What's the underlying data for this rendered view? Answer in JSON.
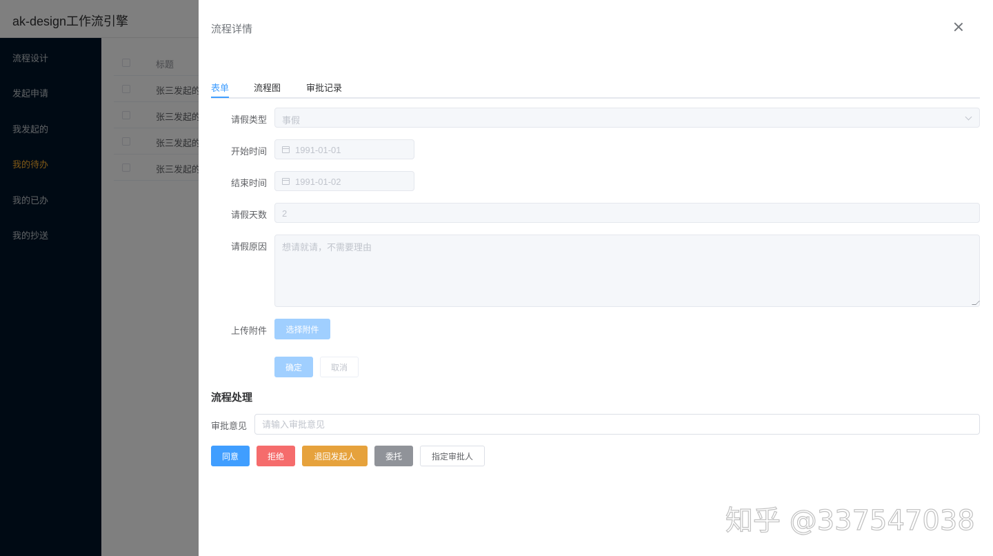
{
  "app": {
    "title": "ak-design工作流引擎"
  },
  "sidebar": {
    "items": [
      {
        "label": "流程设计",
        "active": false
      },
      {
        "label": "发起申请",
        "active": false
      },
      {
        "label": "我发起的",
        "active": false
      },
      {
        "label": "我的待办",
        "active": true
      },
      {
        "label": "我的已办",
        "active": false
      },
      {
        "label": "我的抄送",
        "active": false
      }
    ]
  },
  "table": {
    "header": "标题",
    "rows": [
      "张三发起的",
      "张三发起的",
      "张三发起的",
      "张三发起的"
    ]
  },
  "drawer": {
    "title": "流程详情",
    "tabs": [
      {
        "label": "表单",
        "active": true
      },
      {
        "label": "流程图",
        "active": false
      },
      {
        "label": "审批记录",
        "active": false
      }
    ],
    "form": {
      "leave_type_label": "请假类型",
      "leave_type_value": "事假",
      "start_label": "开始时间",
      "start_value": "1991-01-01",
      "end_label": "结束时间",
      "end_value": "1991-01-02",
      "days_label": "请假天数",
      "days_value": "2",
      "reason_label": "请假原因",
      "reason_value": "想请就请，不需要理由",
      "upload_label": "上传附件",
      "upload_button": "选择附件",
      "confirm_button": "确定",
      "cancel_button": "取消"
    },
    "process": {
      "title": "流程处理",
      "opinion_label": "审批意见",
      "opinion_placeholder": "请输入审批意见",
      "buttons": {
        "agree": "同意",
        "reject": "拒绝",
        "return": "退回发起人",
        "delegate": "委托",
        "assign": "指定审批人"
      }
    }
  },
  "watermark": "知乎 @337547038",
  "colors": {
    "primary": "#409eff",
    "danger": "#f56c6c",
    "warning": "#e6a23c",
    "info": "#909399",
    "sidebar_bg": "#001529",
    "sidebar_active": "#ffb02e"
  }
}
